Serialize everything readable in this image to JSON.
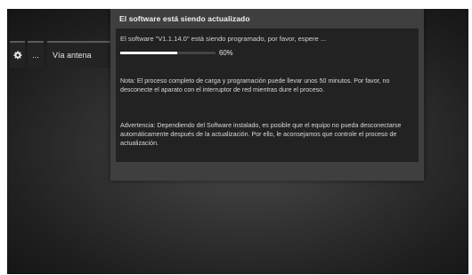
{
  "sidebar": {
    "gear_icon": "gear-icon",
    "more_label": "...",
    "source_label": "Vía antena"
  },
  "dialog": {
    "title": "El software está siendo actualizado",
    "status": "El software \"V1.1.14.0\" está siendo programado, por favor, espere ...",
    "progress_percent": 60,
    "progress_label": "60%",
    "note": "Nota: El proceso completo de carga y programación puede llevar unos 50 minutos. Por favor, no desconecte el aparato con el interruptor de red mientras dure el proceso.",
    "warning": "Advertencia: Dependiendo del Software instalado, es posible que el equipo no pueda desconectarse automáticamente después de la actualización. Por ello, le aconsejamos que controle el proceso de actualización."
  },
  "colors": {
    "dialog_bg": "#3f3f3f",
    "body_bg": "#222222",
    "progress_fill": "#f2f2f2"
  }
}
